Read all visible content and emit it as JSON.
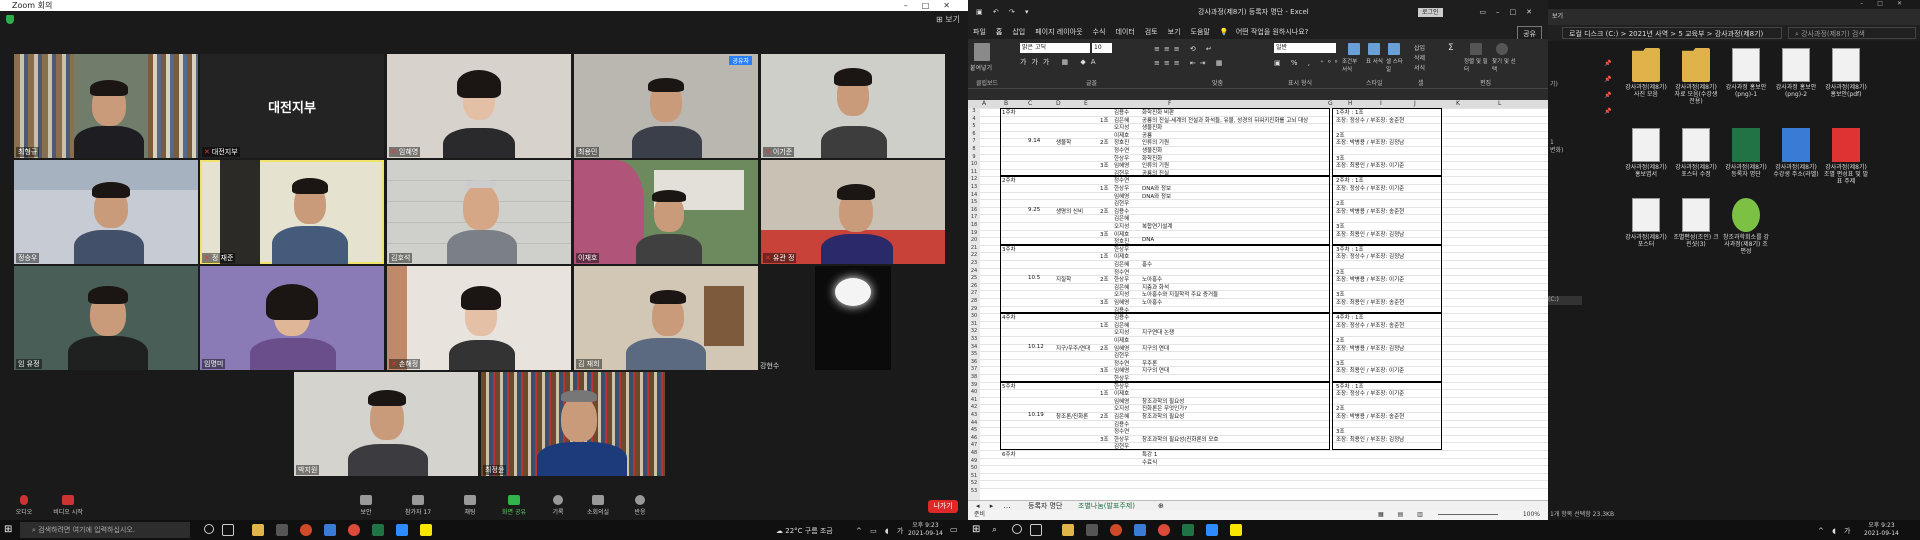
{
  "zoom": {
    "title": "Zoom 회의",
    "view_label": "보기",
    "tiles": [
      {
        "name": "최형규"
      },
      {
        "name": "대전지부",
        "text": "대전지부"
      },
      {
        "name": "임혜영"
      },
      {
        "name": "최용민"
      },
      {
        "name": "이기준"
      },
      {
        "name": "정승우"
      },
      {
        "name": "정 재준"
      },
      {
        "name": "김호석"
      },
      {
        "name": "이재호"
      },
      {
        "name": "유관 정"
      },
      {
        "name": "임 유정"
      },
      {
        "name": "임명미"
      },
      {
        "name": "손해정"
      },
      {
        "name": "김 재희"
      },
      {
        "name": "강현수"
      },
      {
        "name": "박지원"
      },
      {
        "name": "최정윤"
      }
    ],
    "share_badge": "공유자",
    "toolbar": [
      {
        "label": "오디오"
      },
      {
        "label": "비디오 시작"
      },
      {
        "label": "보안"
      },
      {
        "label": "참가자",
        "count": "17"
      },
      {
        "label": "채팅"
      },
      {
        "label": "화면 공유"
      },
      {
        "label": "기록"
      },
      {
        "label": "소회의실"
      },
      {
        "label": "반응"
      }
    ],
    "leave_label": "나가기"
  },
  "excel": {
    "title": "강사과정(제8기) 등록자 명단 - Excel",
    "login_label": "로그인",
    "tabs": [
      "파일",
      "홈",
      "삽입",
      "페이지 레이아웃",
      "수식",
      "데이터",
      "검토",
      "보기",
      "도움말",
      "어떤 작업을 원하시나요?"
    ],
    "share_label": "공유",
    "font_name": "맑은 고딕",
    "font_size": "10",
    "number_format": "일반",
    "ribbon_groups": [
      "클립보드",
      "글꼴",
      "맞춤",
      "표시 형식",
      "스타일",
      "셀",
      "편집"
    ],
    "ribbon_buttons": [
      "붙여넣기",
      "조건부 서식",
      "표 서식",
      "셀 스타일",
      "삽입",
      "삭제",
      "서식",
      "정렬 및 필터",
      "찾기 및 선택"
    ],
    "columns": [
      "A",
      "B",
      "C",
      "D",
      "E",
      "F",
      "G",
      "H",
      "I",
      "J",
      "K",
      "L"
    ],
    "blocks": [
      {
        "week": "1주차",
        "date": "9.14",
        "topic": "생물학",
        "rows": [
          [
            "1조",
            "김용수",
            "화학진화 비판"
          ],
          [
            "",
            "김은혜",
            "공룡의 진실-세계의 전설과 화석들, 유물, 성경의 뒤워키진화를 고뇌 대상"
          ],
          [
            "",
            "오지성",
            "생물진화"
          ],
          [
            "2조",
            "이제호",
            "공룡"
          ],
          [
            "",
            "정호진",
            "인류의 기원"
          ],
          [
            "",
            "정수연",
            "생물진화"
          ],
          [
            "3조",
            "한상우",
            "화학진화"
          ],
          [
            "",
            "임혜영",
            "인류의 기원"
          ],
          [
            "",
            "김현우",
            "공룡의 진실"
          ]
        ],
        "groups": [
          "1주차 : 1조",
          "조장: 정상수 / 부조장: 송준현",
          "2조",
          "조장: 박병용 / 부조장: 김정남",
          "3조",
          "조장: 최용인 / 부조장: 이기준"
        ]
      },
      {
        "week": "2주차",
        "date": "9.25",
        "topic": "생명의 신비",
        "rows": [
          [
            "1조",
            "정수연",
            ""
          ],
          [
            "",
            "한상우",
            "DNA와 정보"
          ],
          [
            "",
            "임혜영",
            "DNA와 정보"
          ],
          [
            "2조",
            "김현우",
            ""
          ],
          [
            "",
            "김용수",
            ""
          ],
          [
            "",
            "김은혜",
            ""
          ],
          [
            "3조",
            "오지성",
            "복합연기설계"
          ],
          [
            "",
            "이제호",
            ""
          ],
          [
            "",
            "정호진",
            "DNA"
          ]
        ],
        "groups": [
          "2주차 : 1조",
          "조장: 정상수 / 부조장: 이기준",
          "2조",
          "조장: 박병용 / 부조장: 송준현",
          "3조",
          "조장: 최용인 / 부조장: 김정남"
        ]
      },
      {
        "week": "3주차",
        "date": "10.5",
        "topic": "지질학",
        "rows": [
          [
            "1조",
            "한상우",
            ""
          ],
          [
            "",
            "이제호",
            ""
          ],
          [
            "",
            "김은혜",
            "홍수"
          ],
          [
            "2조",
            "정수연",
            ""
          ],
          [
            "",
            "한상우",
            "노아홍수"
          ],
          [
            "",
            "김은혜",
            "지층과 화석"
          ],
          [
            "3조",
            "오지성",
            "노아홍수와 지질학적 주요 증거들"
          ],
          [
            "",
            "임혜영",
            "노아홍수"
          ],
          [
            "",
            "김용수",
            ""
          ]
        ],
        "groups": [
          "3주차 : 1조",
          "조장: 정상수 / 부조장: 김정남",
          "2조",
          "조장: 박병용 / 부조장: 이기준",
          "3조",
          "조장: 최용인 / 부조장: 송준현"
        ]
      },
      {
        "week": "4주차",
        "date": "10.12",
        "topic": "지구/우주/연대",
        "rows": [
          [
            "1조",
            "김용수",
            ""
          ],
          [
            "",
            "김은혜",
            ""
          ],
          [
            "",
            "오지성",
            "지구연대 논쟁"
          ],
          [
            "2조",
            "이제호",
            ""
          ],
          [
            "",
            "임혜영",
            "지구의 연대"
          ],
          [
            "",
            "김현우",
            ""
          ],
          [
            "3조",
            "정수연",
            "우주론"
          ],
          [
            "",
            "임혜영",
            "지구의 연대"
          ],
          [
            "",
            "한상우",
            ""
          ]
        ],
        "groups": [
          "4주차 : 1조",
          "조장: 정상수 / 부조장: 송준현",
          "2조",
          "조장: 박병용 / 부조장: 김정남",
          "3조",
          "조장: 최용인 / 부조장: 이기준"
        ]
      },
      {
        "week": "5주차",
        "date": "10.19",
        "topic": "창조론/진화론",
        "rows": [
          [
            "1조",
            "한상우",
            ""
          ],
          [
            "",
            "이제호",
            ""
          ],
          [
            "",
            "임혜영",
            "창조과학의 필요성"
          ],
          [
            "2조",
            "오지성",
            "진화론은 무엇인가?"
          ],
          [
            "",
            "김은혜",
            "창조과학의 필요성"
          ],
          [
            "",
            "김용수",
            ""
          ],
          [
            "3조",
            "정수연",
            ""
          ],
          [
            "",
            "한상우",
            "창조과학의 필요성(진화론의 모호"
          ],
          [
            "",
            "김현우",
            ""
          ]
        ],
        "groups": [
          "5주차 : 1조",
          "조장: 정상수 / 부조장: 이기준",
          "2조",
          "조장: 박병용 / 부조장: 송준현",
          "3조",
          "조장: 최용인 / 부조장: 김정남"
        ]
      }
    ],
    "extra_rows": [
      [
        "6주차",
        "",
        "특강 1"
      ],
      [
        "",
        "",
        "수료식"
      ]
    ],
    "sheet_tabs": [
      "등록자 명단",
      "조별나눔(발표주제)"
    ],
    "status_left": "준비",
    "zoom_pct": "100%"
  },
  "explorer": {
    "ribbon": [
      "보기"
    ],
    "path": [
      "로컬 디스크 (C:)",
      "2021년 사역",
      "5 교육부",
      "강사과정(제8기)"
    ],
    "search_placeholder": "강사과정(제8기) 검색",
    "nav": [
      "기)",
      "1",
      "변화)",
      "",
      "(C:)"
    ],
    "files": [
      {
        "name": "강사과정(제8기) 사진 모음",
        "type": "folder"
      },
      {
        "name": "강사과정(제8기) 자료 모음(수강생 전용)",
        "type": "folder"
      },
      {
        "name": "강사과정 홍보안 (png)-1",
        "type": "image"
      },
      {
        "name": "강사과정 홍보안 (png)-2",
        "type": "image"
      },
      {
        "name": "강사과정(제8기) 홍보안(pdf)",
        "type": "image"
      },
      {
        "name": "강사과정(제8기) 홍보엽서",
        "type": "image"
      },
      {
        "name": "강사과정(제8기) 포스터 수정",
        "type": "image"
      },
      {
        "name": "강사과정(제8기) 등록자 명단",
        "type": "excel"
      },
      {
        "name": "강사과정(제8기) 수강생 주소(라벨)",
        "type": "hwp"
      },
      {
        "name": "강사과정(제8기) 조별 편성표 및 발표 주제",
        "type": "pdf"
      },
      {
        "name": "강사과정(제8기) 포스터",
        "type": "image"
      },
      {
        "name": "조별편성(조인) 크린샷(3)",
        "type": "image"
      },
      {
        "name": "창조과학회소를 강사과정(제8기) 조 편성",
        "type": "kakao"
      }
    ],
    "status": "1개 항목 선택함 23.3KB"
  },
  "taskbar_left": {
    "search_placeholder": "검색하려면 여기에 입력하십시오.",
    "weather": "22°C 구름 조금",
    "time": "오후 9:23",
    "date": "2021-09-14"
  },
  "taskbar_right": {
    "time": "오후 9:23",
    "date": "2021-09-14"
  },
  "colors": {
    "zoom_bg": "#1a1a1a",
    "excel_green": "#217346",
    "leave_red": "#e02828",
    "active_speaker": "#f0e36b"
  }
}
